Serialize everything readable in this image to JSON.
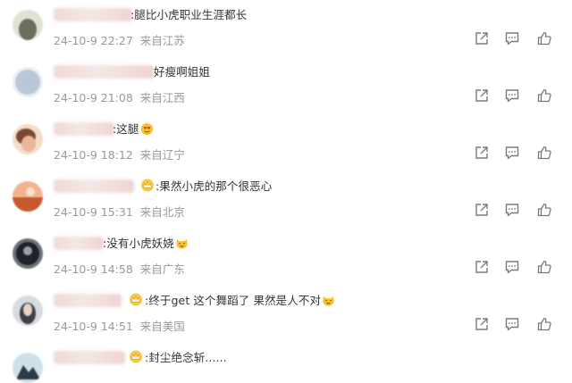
{
  "comments": [
    {
      "avatar": [
        "#dfe3d4",
        "#6a6e5c"
      ],
      "text": ":腿比小虎职业生涯都长",
      "date": "24-10-9 22:27",
      "location": "来自江苏"
    },
    {
      "avatar": [
        "#e9eef4",
        "#b9c8d8"
      ],
      "text": "好瘦啊姐姐",
      "date": "24-10-9 21:08",
      "location": "来自江西"
    },
    {
      "avatar": [
        "#f3dccb",
        "#7a4a34"
      ],
      "text": ":这腿",
      "date": "24-10-9 18:12",
      "location": "来自辽宁",
      "emoji": "heart-eyes-emoji"
    },
    {
      "avatar": [
        "#f2b48f",
        "#c65a2f"
      ],
      "text": ":果然小虎的那个很恶心",
      "date": "24-10-9 15:31",
      "location": "来自北京",
      "badge": "crown-badge-icon"
    },
    {
      "avatar": [
        "#6c7078",
        "#1f2228"
      ],
      "text": ":没有小虎妖娆",
      "date": "24-10-9 14:58",
      "location": "来自广东",
      "emoji": "cat-face-emoji"
    },
    {
      "avatar": [
        "#d7dbe0",
        "#3c3f45"
      ],
      "text": ":终于get 这个舞蹈了 果然是人不对",
      "date": "24-10-9 14:51",
      "location": "来自美国",
      "badge": "crown-badge-icon",
      "emoji": "cat-face-emoji"
    },
    {
      "avatar": [
        "#cfe0ea",
        "#2e3a44"
      ],
      "text": ":封尘绝念斩......",
      "badge": "crown-badge-icon"
    }
  ],
  "icons": {
    "share": "share-icon",
    "comment": "comment-icon",
    "like": "like-icon"
  },
  "colors": {
    "text": "#333333",
    "meta": "#999999",
    "icon": "#7a7a7a",
    "emoji": "#f5c22e"
  }
}
